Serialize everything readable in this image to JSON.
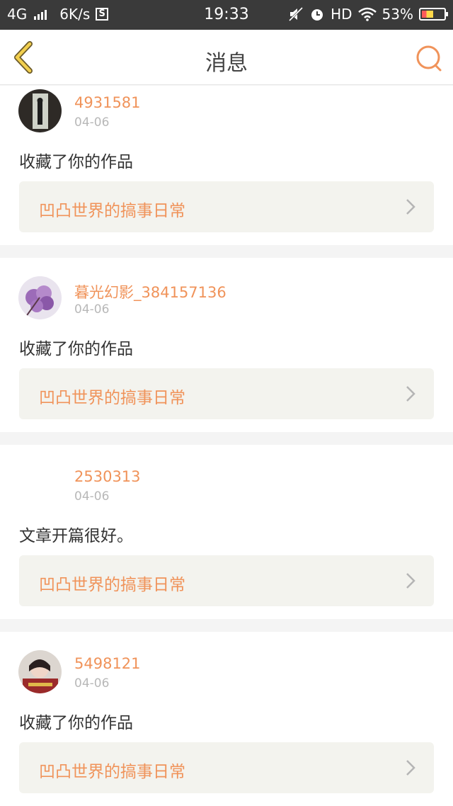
{
  "status_bar": {
    "network": "4G",
    "speed": "6K/s",
    "sim_badge": "S",
    "time": "19:33",
    "hd": "HD",
    "battery": "53%",
    "battery_level": 0.53
  },
  "header": {
    "title": "消息",
    "accent_color": "#f0935a",
    "back_icon_color": "#f2cf4e"
  },
  "notifications": [
    {
      "username": "4931581",
      "date": "04-06",
      "action": "收藏了你的作品",
      "work_title": "凹凸世界的搞事日常",
      "avatar": "photo-dark-doorway"
    },
    {
      "username": "暮光幻影_384157136",
      "date": "04-06",
      "action": "收藏了你的作品",
      "work_title": "凹凸世界的搞事日常",
      "avatar": "purple-blossom"
    },
    {
      "username": "2530313",
      "date": "04-06",
      "action": "文章开篇很好。",
      "work_title": "凹凸世界的搞事日常",
      "avatar": "none"
    },
    {
      "username": "5498121",
      "date": "04-06",
      "action": "收藏了你的作品",
      "work_title": "凹凸世界的搞事日常",
      "avatar": "portrait-girl"
    }
  ]
}
